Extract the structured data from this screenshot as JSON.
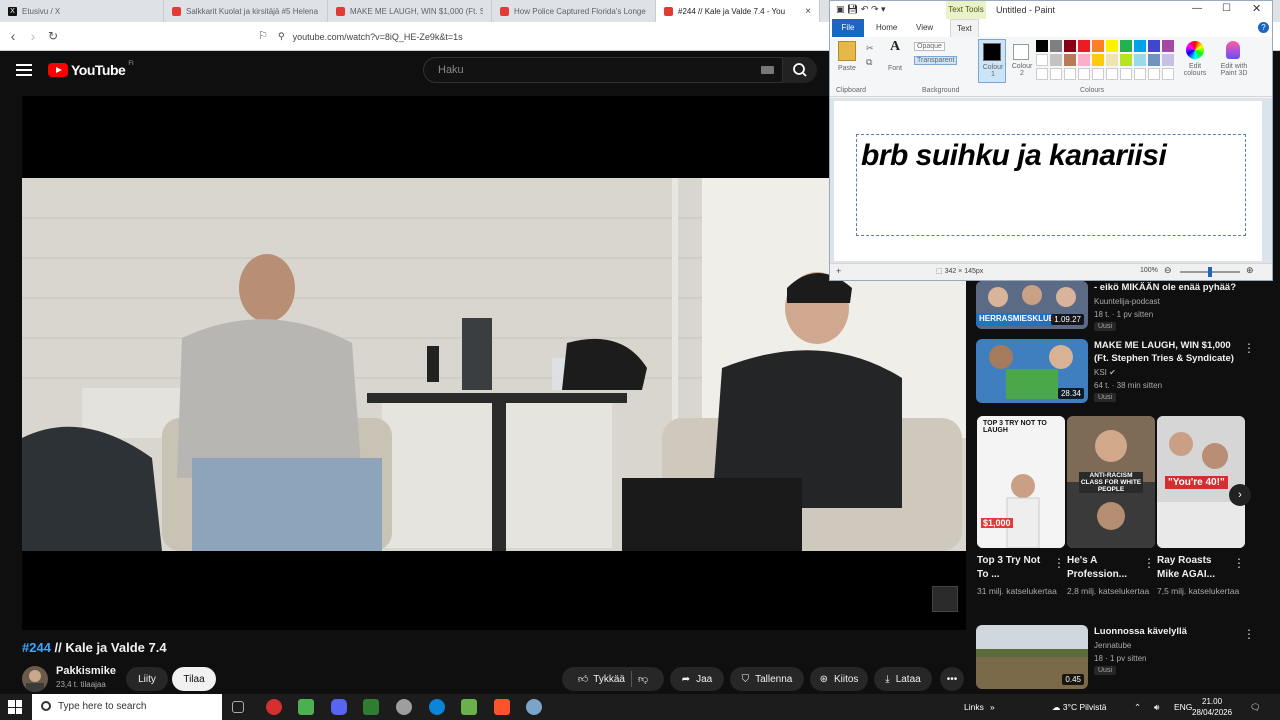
{
  "browser": {
    "tabs": [
      {
        "label": "Etusivu / X",
        "favicon": "x-icon"
      },
      {
        "label": "Salkkarit Kuolat ja kirsitäjä #5 Helena",
        "favicon": "youtube-icon"
      },
      {
        "label": "MAKE ME LAUGH, WIN $1,000 (Ft. St",
        "favicon": "youtube-icon"
      },
      {
        "label": "How Police Captured Florida's Longe",
        "favicon": "youtube-icon"
      },
      {
        "label": "#244 // Kale ja Valde 7.4 - You",
        "favicon": "youtube-icon"
      }
    ],
    "tab_close": "×",
    "url": "youtube.com/watch?v=8iQ_HE-Ze9k&t=1s"
  },
  "youtube": {
    "logo_text": "YouTube",
    "country_code": "FI",
    "search_placeholder": "Haku",
    "video": {
      "title_number": "#244",
      "title_rest": " // Kale ja Valde 7.4",
      "channel_name": "Pakkismike",
      "subscribers": "23,4 t. tilaajaa",
      "join_label": "Liity",
      "subscribe_label": "Tilaa",
      "like_label": "Tykkää",
      "share_label": "Jaa",
      "save_label": "Tallenna",
      "thanks_label": "Kiitos",
      "download_label": "Lataa"
    },
    "recommendations": [
      {
        "title": "- eikö MIKÄÄN ole enää pyhää?",
        "channel": "Kuuntelija-podcast",
        "meta": "18 t. · 1 pv sitten",
        "badge": "Uusi",
        "duration": "1.09.27",
        "thumb_text": "HERRASMIESKLUBI"
      },
      {
        "title": "MAKE ME LAUGH, WIN $1,000 (Ft. Stephen Tries & Syndicate)",
        "channel": "KSI",
        "meta": "64 t. · 38 min sitten",
        "badge": "Uusi",
        "duration": "28.34"
      },
      {
        "title": "Luonnossa kävelyllä",
        "channel": "Jennatube",
        "meta": "18 · 1 pv sitten",
        "badge": "Uusi",
        "duration": "0.45"
      }
    ],
    "shorts": [
      {
        "title": "Top 3 Try Not To ...",
        "views": "31 milj. katselukertaa",
        "thumb_text": "TOP 3 TRY NOT TO LAUGH",
        "sub_text": "$1,000"
      },
      {
        "title": "He's A Profession...",
        "views": "2,8 milj. katselukertaa",
        "thumb_text": "ANTI-RACISM CLASS FOR WHITE PEOPLE"
      },
      {
        "title": "Ray Roasts Mike AGAI...",
        "views": "7,5 milj. katselukertaa",
        "thumb_text": "\"You're 40!\""
      }
    ]
  },
  "paint": {
    "window_title": "Untitled - Paint",
    "text_tools_tab": "Text Tools",
    "menu": {
      "file": "File",
      "home": "Home",
      "view": "View",
      "text": "Text"
    },
    "ribbon": {
      "paste": "Paste",
      "font": "Font",
      "opaque": "Opaque",
      "transparent": "Transparent",
      "colour1": "Colour 1",
      "colour2": "Colour 2",
      "edit_colours": "Edit colours",
      "edit_paint3d": "Edit with Paint 3D",
      "clipboard": "Clipboard",
      "background": "Background",
      "colours": "Colours"
    },
    "canvas_text": "brb suihku ja kanariisi",
    "selection_size": "342 × 145px",
    "zoom": "100%"
  },
  "taskbar": {
    "search_placeholder": "Type here to search",
    "links": "Links",
    "weather": "3°C  Pilvistä",
    "language": "ENG",
    "time": "21.00",
    "date": "28/04/2026"
  },
  "colors": {
    "youtube_red": "#ff0000",
    "link_blue": "#3ea6ff",
    "paint_file_blue": "#1a66c2"
  }
}
